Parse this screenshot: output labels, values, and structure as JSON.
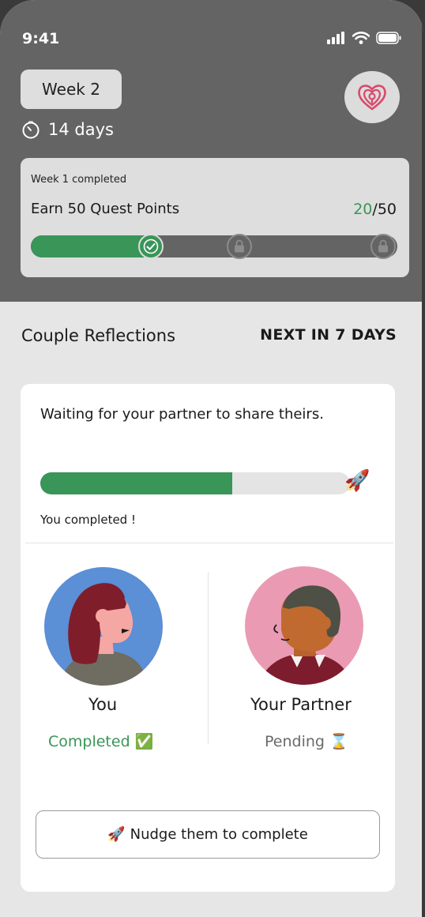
{
  "status_bar": {
    "time": "9:41"
  },
  "header": {
    "week_label": "Week 2",
    "days_label": "14 days"
  },
  "quest": {
    "subtitle": "Week 1 completed",
    "title": "Earn 50 Quest Points",
    "points_earned": "20",
    "points_separator": "/",
    "points_total": "50",
    "progress_fraction": 0.33
  },
  "reflections": {
    "title": "Couple Reflections",
    "next_label": "NEXT IN 7 DAYS",
    "waiting_text": "Waiting for your partner to share theirs.",
    "progress_fraction": 0.62,
    "completed_text": "You completed !",
    "you": {
      "name": "You",
      "status": "Completed ✅"
    },
    "partner": {
      "name": "Your Partner",
      "status": "Pending ⌛"
    },
    "nudge_label": "Nudge them to complete",
    "nudge_emoji": "🚀"
  },
  "colors": {
    "accent_green": "#3a9558",
    "header_gray": "#646464",
    "logo_pink": "#d94a6a"
  }
}
